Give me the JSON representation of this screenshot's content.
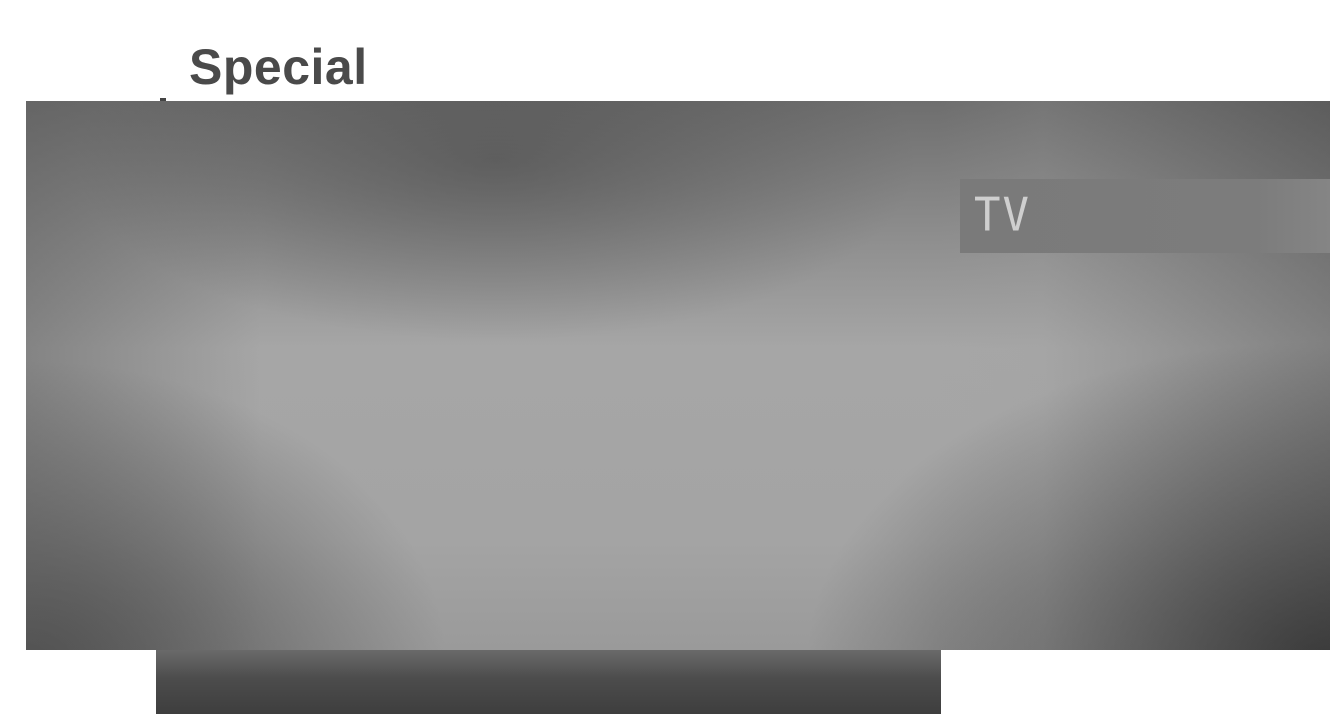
{
  "header": {
    "title": "Special"
  },
  "menu": {
    "selected_option": "TV"
  },
  "colors": {
    "title_text": "#4a4a4a",
    "screen_base": "#a6a6a6",
    "highlight": "#7a7a7a",
    "option_text": "#cfcfcf",
    "bottom_bar": "#4c4c4c"
  }
}
